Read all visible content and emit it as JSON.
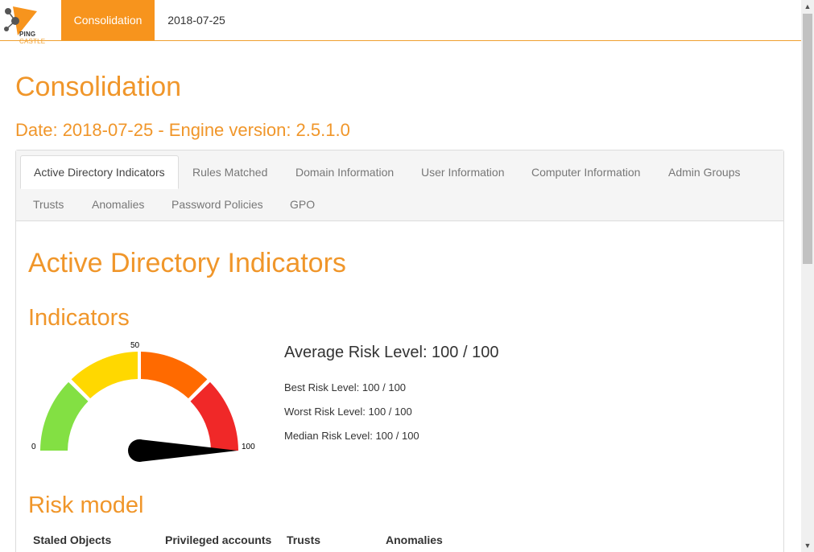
{
  "brand": {
    "logo_word1": "PING",
    "logo_word2": "CASTLE"
  },
  "navbar": {
    "active_label": "Consolidation",
    "date_label": "2018-07-25"
  },
  "page": {
    "title": "Consolidation",
    "subtitle": "Date: 2018-07-25 - Engine version: 2.5.1.0"
  },
  "tabs": [
    "Active Directory Indicators",
    "Rules Matched",
    "Domain Information",
    "User Information",
    "Computer Information",
    "Admin Groups",
    "Trusts",
    "Anomalies",
    "Password Policies",
    "GPO"
  ],
  "section": {
    "title": "Active Directory Indicators",
    "indicators_heading": "Indicators",
    "risk_model_heading": "Risk model"
  },
  "gauge": {
    "min_label": "0",
    "mid_label": "50",
    "max_label": "100",
    "value": 100,
    "min": 0,
    "max": 100,
    "colors": {
      "green": "#83e043",
      "yellow": "#ffd800",
      "orange": "#ff6a00",
      "red": "#f02828",
      "needle": "#000000"
    }
  },
  "risk": {
    "average": "Average Risk Level: 100 / 100",
    "best": "Best Risk Level: 100 / 100",
    "worst": "Worst Risk Level: 100 / 100",
    "median": "Median Risk Level: 100 / 100"
  },
  "risk_model_columns": [
    "Staled Objects",
    "Privileged accounts",
    "Trusts",
    "Anomalies"
  ],
  "colors": {
    "accent": "#f7941d",
    "heading": "#f0962a"
  }
}
